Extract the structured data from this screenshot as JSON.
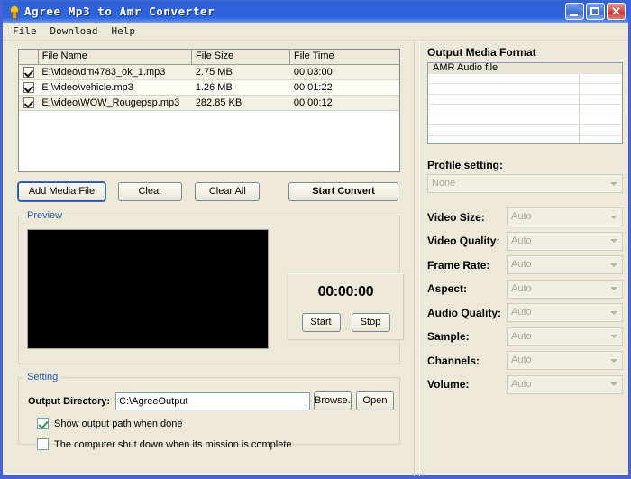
{
  "window": {
    "title": "Agree Mp3 to Amr Converter",
    "icon": "app-icon",
    "minimize_label": "",
    "maximize_label": "",
    "close_label": "✕"
  },
  "menu": {
    "items": [
      {
        "label": "File"
      },
      {
        "label": "Download"
      },
      {
        "label": "Help"
      }
    ]
  },
  "file_list": {
    "columns": [
      "",
      "File Name",
      "File Size",
      "File Time"
    ],
    "rows": [
      {
        "checked": true,
        "name": "E:\\video\\dm4783_ok_1.mp3",
        "size": "2.75 MB",
        "time": "00:03:00"
      },
      {
        "checked": true,
        "name": "E:\\video\\vehicle.mp3",
        "size": "1.26 MB",
        "time": "00:01:22"
      },
      {
        "checked": true,
        "name": "E:\\video\\WOW_Rougepsp.mp3",
        "size": "282.85 KB",
        "time": "00:00:12"
      }
    ]
  },
  "toolbar": {
    "add_media_label": "Add Media File",
    "clear_label": "Clear",
    "clear_all_label": "Clear All",
    "start_convert_label": "Start Convert"
  },
  "preview": {
    "legend": "Preview",
    "timer": "00:00:00",
    "start_label": "Start",
    "stop_label": "Stop"
  },
  "setting": {
    "legend": "Setting",
    "output_dir_label": "Output Directory:",
    "output_dir_value": "C:\\AgreeOutput",
    "output_dir_placeholder": "",
    "browse_label": "Browse..",
    "open_label": "Open",
    "show_path_label": "Show output path when done",
    "show_path_checked": true,
    "shutdown_label": "The computer shut down when its mission is complete",
    "shutdown_checked": false
  },
  "output_format": {
    "title": "Output Media Format",
    "items": [
      "AMR Audio file",
      "",
      "",
      "",
      "",
      "",
      "",
      ""
    ],
    "selected_index": 0,
    "profile_label": "Profile setting:",
    "profile_value": "None"
  },
  "params": [
    {
      "label": "Video Size:",
      "value": "Auto"
    },
    {
      "label": "Video Quality:",
      "value": "Auto"
    },
    {
      "label": "Frame Rate:",
      "value": "Auto"
    },
    {
      "label": "Aspect:",
      "value": "Auto"
    },
    {
      "label": "Audio Quality:",
      "value": "Auto"
    },
    {
      "label": "Sample:",
      "value": "Auto"
    },
    {
      "label": "Channels:",
      "value": "Auto"
    },
    {
      "label": "Volume:",
      "value": "Auto"
    }
  ],
  "colors": {
    "window_face": "#ECE9D8",
    "title_blue": "#2F63DC",
    "frame_blue": "#4662D4",
    "legend_blue": "#2A5DB0",
    "disabled_text": "#ACA899",
    "close_red": "#C43A32"
  }
}
